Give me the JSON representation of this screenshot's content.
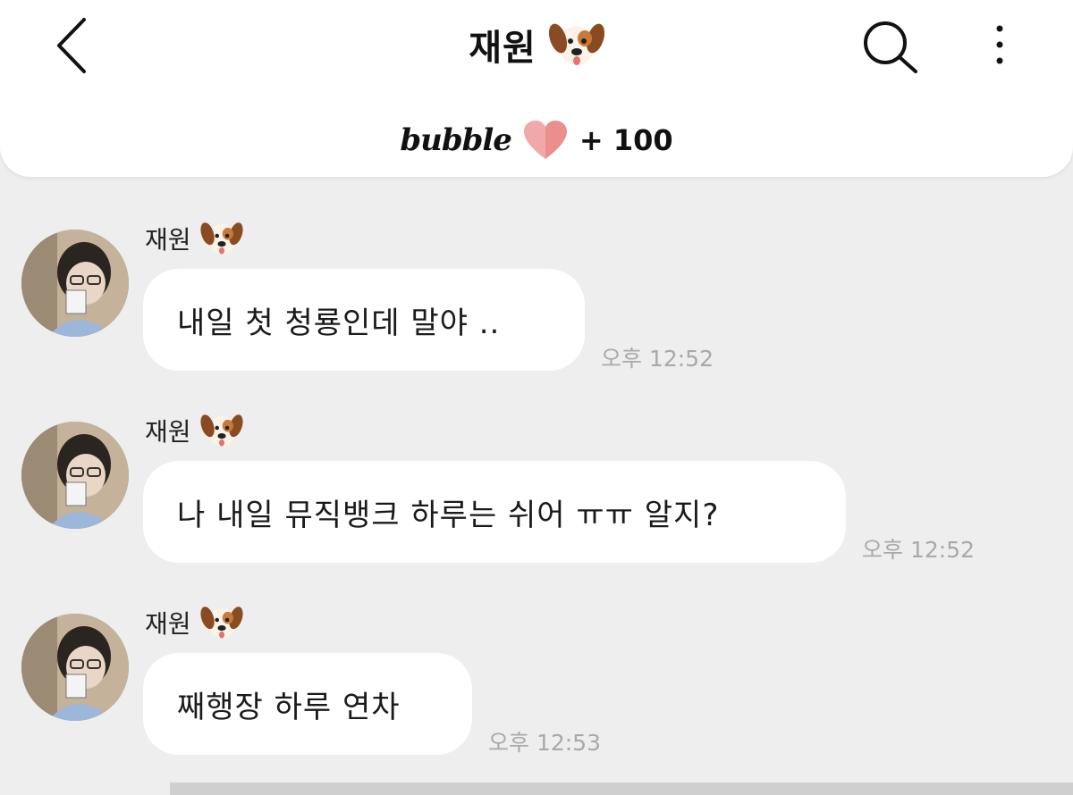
{
  "header": {
    "title": "재원",
    "title_emoji": "dog-face-icon",
    "bubble_logo": "bubble",
    "bubble_count": "+ 100"
  },
  "colors": {
    "background": "#eeeeee",
    "header_bg": "#ffffff",
    "bubble_bg": "#ffffff",
    "heart": "#e98b8b",
    "time_text": "#a9a9a9"
  },
  "messages": [
    {
      "sender": "재원",
      "text": "내일 첫 청룡인데 말야 ..",
      "time": "오후 12:52"
    },
    {
      "sender": "재원",
      "text": "나 내일 뮤직뱅크 하루는 쉬어 ㅠㅠ 알지?",
      "time": "오후 12:52"
    },
    {
      "sender": "재원",
      "text": "째행장 하루 연차",
      "time": "오후 12:53"
    }
  ]
}
